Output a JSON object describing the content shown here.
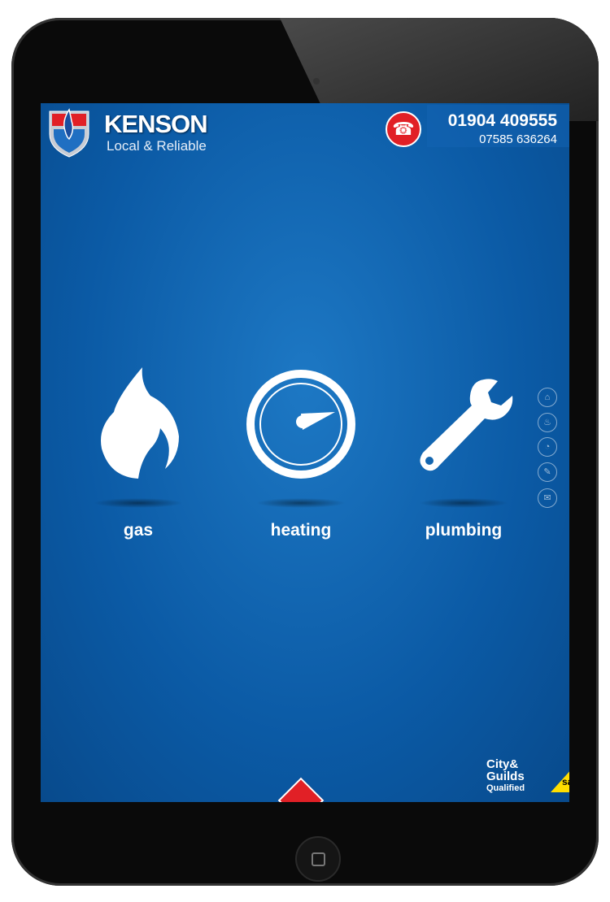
{
  "header": {
    "brand": "KENSON",
    "tagline": "Local & Reliable",
    "phone_primary": "01904 409555",
    "phone_secondary": "07585 636264",
    "phone_icon": "telephone-icon"
  },
  "services": [
    {
      "label": "gas",
      "icon": "flame-icon"
    },
    {
      "label": "heating",
      "icon": "gauge-icon"
    },
    {
      "label": "plumbing",
      "icon": "wrench-icon"
    }
  ],
  "side_nav": [
    {
      "icon": "home-icon"
    },
    {
      "icon": "flame-icon"
    },
    {
      "icon": "gauge-icon"
    },
    {
      "icon": "wrench-icon"
    },
    {
      "icon": "mail-icon"
    }
  ],
  "badges": {
    "city_guilds_1": "City&",
    "city_guilds_2": "Guilds",
    "city_guilds_3": "Qualified",
    "gas_safe": "safe"
  },
  "colors": {
    "accent": "#e12026",
    "background": "#0b5aa5",
    "gas_safe": "#ffde00"
  }
}
